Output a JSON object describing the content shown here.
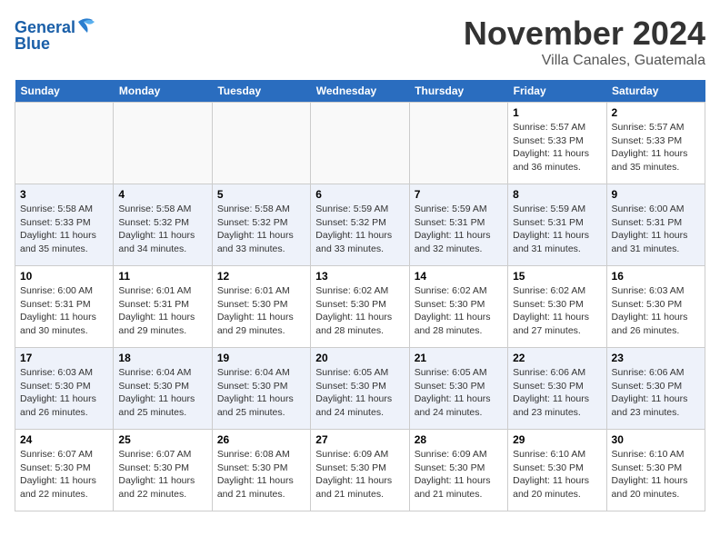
{
  "header": {
    "logo_line1": "General",
    "logo_line2": "Blue",
    "month_title": "November 2024",
    "location": "Villa Canales, Guatemala"
  },
  "days_of_week": [
    "Sunday",
    "Monday",
    "Tuesday",
    "Wednesday",
    "Thursday",
    "Friday",
    "Saturday"
  ],
  "weeks": [
    [
      {
        "day": "",
        "info": ""
      },
      {
        "day": "",
        "info": ""
      },
      {
        "day": "",
        "info": ""
      },
      {
        "day": "",
        "info": ""
      },
      {
        "day": "",
        "info": ""
      },
      {
        "day": "1",
        "info": "Sunrise: 5:57 AM\nSunset: 5:33 PM\nDaylight: 11 hours and 36 minutes."
      },
      {
        "day": "2",
        "info": "Sunrise: 5:57 AM\nSunset: 5:33 PM\nDaylight: 11 hours and 35 minutes."
      }
    ],
    [
      {
        "day": "3",
        "info": "Sunrise: 5:58 AM\nSunset: 5:33 PM\nDaylight: 11 hours and 35 minutes."
      },
      {
        "day": "4",
        "info": "Sunrise: 5:58 AM\nSunset: 5:32 PM\nDaylight: 11 hours and 34 minutes."
      },
      {
        "day": "5",
        "info": "Sunrise: 5:58 AM\nSunset: 5:32 PM\nDaylight: 11 hours and 33 minutes."
      },
      {
        "day": "6",
        "info": "Sunrise: 5:59 AM\nSunset: 5:32 PM\nDaylight: 11 hours and 33 minutes."
      },
      {
        "day": "7",
        "info": "Sunrise: 5:59 AM\nSunset: 5:31 PM\nDaylight: 11 hours and 32 minutes."
      },
      {
        "day": "8",
        "info": "Sunrise: 5:59 AM\nSunset: 5:31 PM\nDaylight: 11 hours and 31 minutes."
      },
      {
        "day": "9",
        "info": "Sunrise: 6:00 AM\nSunset: 5:31 PM\nDaylight: 11 hours and 31 minutes."
      }
    ],
    [
      {
        "day": "10",
        "info": "Sunrise: 6:00 AM\nSunset: 5:31 PM\nDaylight: 11 hours and 30 minutes."
      },
      {
        "day": "11",
        "info": "Sunrise: 6:01 AM\nSunset: 5:31 PM\nDaylight: 11 hours and 29 minutes."
      },
      {
        "day": "12",
        "info": "Sunrise: 6:01 AM\nSunset: 5:30 PM\nDaylight: 11 hours and 29 minutes."
      },
      {
        "day": "13",
        "info": "Sunrise: 6:02 AM\nSunset: 5:30 PM\nDaylight: 11 hours and 28 minutes."
      },
      {
        "day": "14",
        "info": "Sunrise: 6:02 AM\nSunset: 5:30 PM\nDaylight: 11 hours and 28 minutes."
      },
      {
        "day": "15",
        "info": "Sunrise: 6:02 AM\nSunset: 5:30 PM\nDaylight: 11 hours and 27 minutes."
      },
      {
        "day": "16",
        "info": "Sunrise: 6:03 AM\nSunset: 5:30 PM\nDaylight: 11 hours and 26 minutes."
      }
    ],
    [
      {
        "day": "17",
        "info": "Sunrise: 6:03 AM\nSunset: 5:30 PM\nDaylight: 11 hours and 26 minutes."
      },
      {
        "day": "18",
        "info": "Sunrise: 6:04 AM\nSunset: 5:30 PM\nDaylight: 11 hours and 25 minutes."
      },
      {
        "day": "19",
        "info": "Sunrise: 6:04 AM\nSunset: 5:30 PM\nDaylight: 11 hours and 25 minutes."
      },
      {
        "day": "20",
        "info": "Sunrise: 6:05 AM\nSunset: 5:30 PM\nDaylight: 11 hours and 24 minutes."
      },
      {
        "day": "21",
        "info": "Sunrise: 6:05 AM\nSunset: 5:30 PM\nDaylight: 11 hours and 24 minutes."
      },
      {
        "day": "22",
        "info": "Sunrise: 6:06 AM\nSunset: 5:30 PM\nDaylight: 11 hours and 23 minutes."
      },
      {
        "day": "23",
        "info": "Sunrise: 6:06 AM\nSunset: 5:30 PM\nDaylight: 11 hours and 23 minutes."
      }
    ],
    [
      {
        "day": "24",
        "info": "Sunrise: 6:07 AM\nSunset: 5:30 PM\nDaylight: 11 hours and 22 minutes."
      },
      {
        "day": "25",
        "info": "Sunrise: 6:07 AM\nSunset: 5:30 PM\nDaylight: 11 hours and 22 minutes."
      },
      {
        "day": "26",
        "info": "Sunrise: 6:08 AM\nSunset: 5:30 PM\nDaylight: 11 hours and 21 minutes."
      },
      {
        "day": "27",
        "info": "Sunrise: 6:09 AM\nSunset: 5:30 PM\nDaylight: 11 hours and 21 minutes."
      },
      {
        "day": "28",
        "info": "Sunrise: 6:09 AM\nSunset: 5:30 PM\nDaylight: 11 hours and 21 minutes."
      },
      {
        "day": "29",
        "info": "Sunrise: 6:10 AM\nSunset: 5:30 PM\nDaylight: 11 hours and 20 minutes."
      },
      {
        "day": "30",
        "info": "Sunrise: 6:10 AM\nSunset: 5:30 PM\nDaylight: 11 hours and 20 minutes."
      }
    ]
  ]
}
